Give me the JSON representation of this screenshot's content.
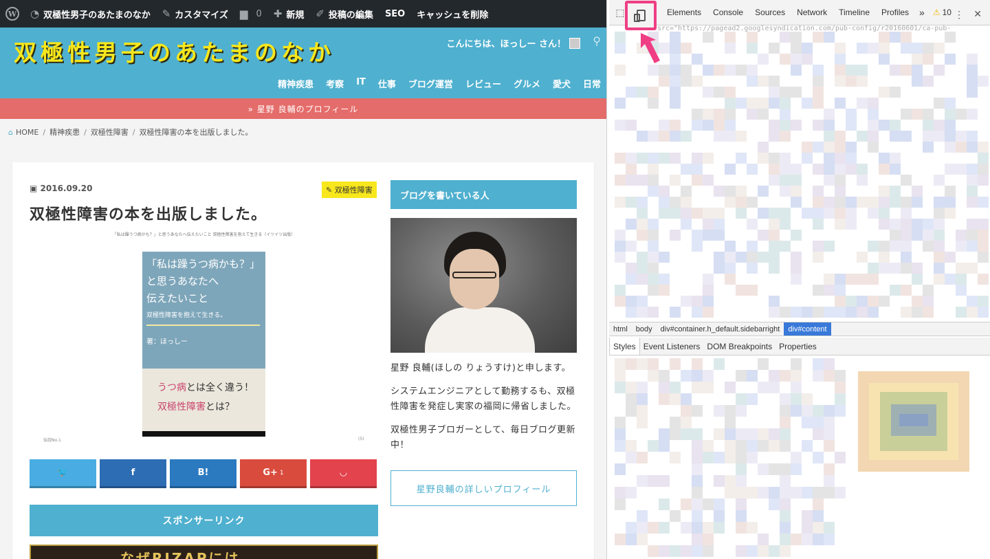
{
  "admin_bar": {
    "wp_logo": "W",
    "site_name": "双極性男子のあたまのなか",
    "customize": "カスタマイズ",
    "comments_count": "0",
    "new": "新規",
    "edit_post": "投稿の編集",
    "seo": "SEO",
    "clear_cache": "キャッシュを削除",
    "icons": {
      "dashboard": "gauge-icon",
      "customize": "brush-icon",
      "comments": "comment-icon",
      "new": "plus-icon",
      "edit": "pencil-icon"
    }
  },
  "header": {
    "site_title": "双極性男子のあたまのなか",
    "greeting": "こんにちは、ほっしー さん！",
    "search_icon": "search-icon",
    "nav": [
      "精神疾患",
      "考察",
      "IT",
      "仕事",
      "ブログ運営",
      "レビュー",
      "グルメ",
      "愛犬",
      "日常"
    ],
    "colors": {
      "header_bg": "#4fb0cf",
      "title": "#f7e71b",
      "profile_bar": "#e46c6a"
    }
  },
  "profile_bar": {
    "label": "» 星野 良輔のプロフィール"
  },
  "breadcrumb": [
    "HOME",
    "精神疾患",
    "双極性障害",
    "双極性障害の本を出版しました。"
  ],
  "post": {
    "date": "2016.09.20",
    "category": "双極性障害",
    "title": "双極性障害の本を出版しました。",
    "cover_caption": "「私は躁うつ病かも？」と思うあなたへ伝えたいこと 双極性障害を抱えて生きる（イツイツ出版）",
    "book": {
      "line1": "「私は躁うつ病かも？」",
      "line2": "と思うあなたへ",
      "line3": "伝えたいこと",
      "subtitle": "双極性障害を抱えて生きる。",
      "author": "著：ほっしー",
      "tag1_pink": "うつ病",
      "tag1_rest": "とは全く違う！",
      "tag2_pink": "双極性障害",
      "tag2_rest": "とは？",
      "publisher": "イツイツ出版"
    },
    "cover_foot_left": "伝説No.1",
    "cover_foot_right": "(5)",
    "share": {
      "twitter": "🐦",
      "facebook": "f",
      "hatena": "B!",
      "gplus": "G+",
      "gplus_count": "1",
      "pocket": "◡"
    },
    "sponsor": "スポンサーリンク",
    "ad_text": "なぜRIZAPには"
  },
  "sidebar": {
    "author_heading": "ブログを書いている人",
    "bio1": "星野 良輔(ほしの りょうすけ)と申します。",
    "bio2": "システムエンジニアとして勤務するも、双極性障害を発症し実家の福岡に帰省しました。",
    "bio3": "双極性男子ブロガーとして、毎日ブログ更新中！",
    "profile_link": "星野良輔の詳しいプロフィール"
  },
  "devtools": {
    "tabs": [
      "Elements",
      "Console",
      "Sources",
      "Network",
      "Timeline",
      "Profiles"
    ],
    "more": "»",
    "warnings": "10",
    "code_snippet": "src=\"https://pagead2.googlesyndication.com/pub-config/r20160601/ca-pub-",
    "dom_crumbs": [
      "html",
      "body",
      "div#container.h_default.sidebarright",
      "div#content"
    ],
    "styles_tabs": [
      "Styles",
      "Event Listeners",
      "DOM Breakpoints",
      "Properties"
    ],
    "highlight_color": "#ef3e84",
    "icons": {
      "inspect": "cursor-icon",
      "device": "device-mode-icon",
      "menu": "kebab-icon",
      "close": "close-icon"
    }
  }
}
